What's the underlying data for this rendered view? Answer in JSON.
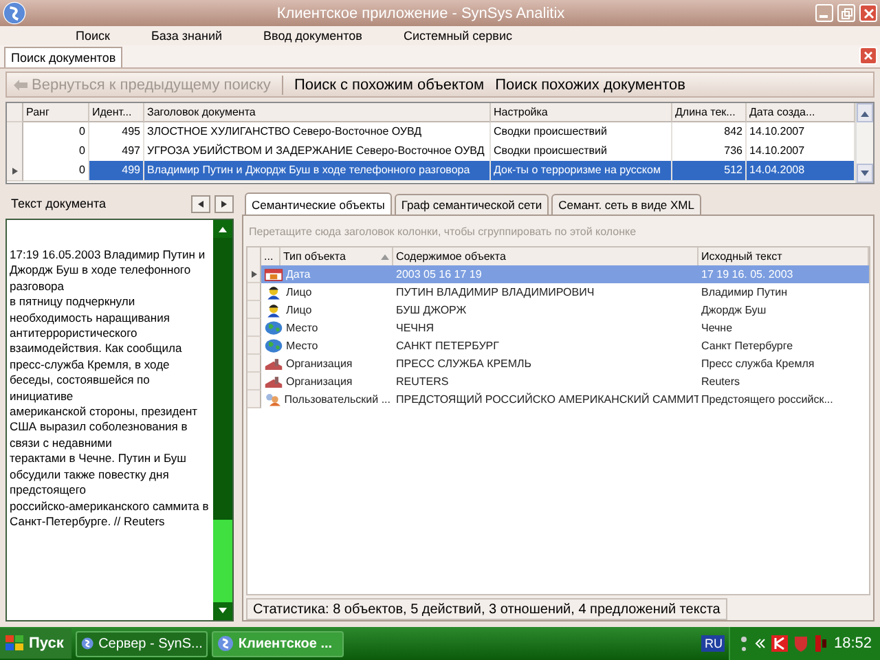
{
  "window": {
    "title": "Клиентское приложение - SynSys Analitix"
  },
  "menu": [
    "Поиск",
    "База знаний",
    "Ввод документов",
    "Системный сервис"
  ],
  "doc_tabs": [
    {
      "label": "Поиск документов",
      "selected": true
    }
  ],
  "toolbar": [
    {
      "label": "Вернуться к предыдущему поиску",
      "disabled": true
    },
    {
      "label": "Поиск с похожим объектом",
      "disabled": false
    },
    {
      "label": "Поиск похожих документов",
      "disabled": false
    }
  ],
  "documents": {
    "columns": [
      "Ранг",
      "Идент...",
      "Заголовок документа",
      "Настройка",
      "Длина тек...",
      "Дата созда..."
    ],
    "rows": [
      {
        "selected": false,
        "cells": [
          "0",
          "495",
          "ЗЛОСТНОЕ ХУЛИГАНСТВО Северо-Восточное ОУВД",
          "Сводки происшествий",
          "842",
          "14.10.2007"
        ]
      },
      {
        "selected": false,
        "cells": [
          "0",
          "497",
          "УГРОЗА УБИЙСТВОМ И ЗАДЕРЖАНИЕ Северо-Восточное ОУВД",
          "Сводки происшествий",
          "736",
          "14.10.2007"
        ]
      },
      {
        "selected": true,
        "cells": [
          "0",
          "499",
          "Владимир Путин и Джордж Буш в ходе телефонного разговора",
          "Док-ты о терроризме на русском",
          "512",
          "14.04.2008"
        ]
      }
    ]
  },
  "text_panel": {
    "title": "Текст документа",
    "lines": [
      "17:19 16.05.2003  Владимир Путин и Джордж Буш в ходе телефонного разговора",
      "в  пятницу  подчеркнули необходимость  наращивания антитеррористического взаимодействия. Как сообщила пресс-служба Кремля,  в ходе беседы, состоявшейся  по инициативе",
      "американской стороны, президент США  выразил соболезнования  в связи  с недавними",
      "терактами в Чечне. Путин  и  Буш обсудили  также  повестку  дня предстоящего",
      " российско-американского саммита в Санкт-Петербурге.  // Reuters"
    ]
  },
  "object_tabs": [
    {
      "label": "Семантические объекты",
      "selected": true
    },
    {
      "label": "Граф семантической сети",
      "selected": false
    },
    {
      "label": "Семант. сеть в виде XML",
      "selected": false
    }
  ],
  "group_hint": "Перетащите сюда заголовок колонки, чтобы сгруппировать по этой колонке",
  "objects": {
    "columns": [
      "...",
      "Тип объекта",
      "Содержимое объекта",
      "Исходный текст"
    ],
    "rows": [
      {
        "kind": "date",
        "selected": true,
        "type": "Дата",
        "content": "2003 05 16 17 19",
        "source": "17 19 16. 05. 2003"
      },
      {
        "kind": "person",
        "selected": false,
        "type": "Лицо",
        "content": "ПУТИН ВЛАДИМИР ВЛАДИМИРОВИЧ",
        "source": "Владимир Путин"
      },
      {
        "kind": "person",
        "selected": false,
        "type": "Лицо",
        "content": "БУШ ДЖОРЖ",
        "source": "Джордж Буш"
      },
      {
        "kind": "place",
        "selected": false,
        "type": "Место",
        "content": "ЧЕЧНЯ",
        "source": "Чечне"
      },
      {
        "kind": "place",
        "selected": false,
        "type": "Место",
        "content": "САНКТ ПЕТЕРБУРГ",
        "source": "Санкт Петербурге"
      },
      {
        "kind": "org",
        "selected": false,
        "type": "Организация",
        "content": "ПРЕСС СЛУЖБА КРЕМЛЬ",
        "source": "Пресс служба Кремля"
      },
      {
        "kind": "org",
        "selected": false,
        "type": "Организация",
        "content": "REUTERS",
        "source": "Reuters"
      },
      {
        "kind": "custom",
        "selected": false,
        "type": "Пользовательский ...",
        "content": "ПРЕДСТОЯЩИЙ РОССИЙСКО АМЕРИКАНСКИЙ САММИТ",
        "source": "Предстоящего российск..."
      }
    ]
  },
  "status": "Статистика: 8 объектов, 5 действий, 3 отношений, 4 предложений текста",
  "taskbar": {
    "start": "Пуск",
    "tasks": [
      {
        "label": "Сервер - SynS...",
        "selected": false
      },
      {
        "label": "Клиентское ...",
        "selected": true
      }
    ],
    "lang": "RU",
    "clock": "18:52"
  }
}
